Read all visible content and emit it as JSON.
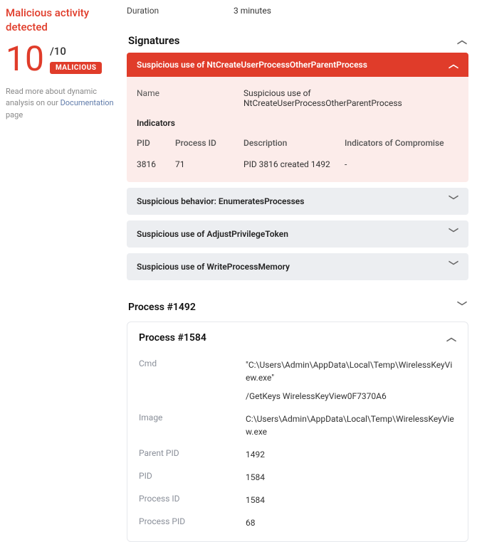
{
  "sidebar": {
    "title": "Malicious activity detected",
    "score": "10",
    "out_of": "/10",
    "badge": "MALICIOUS",
    "read_more_pre": "Read more about dynamic analysis on our ",
    "read_more_link": "Documentation",
    "read_more_post": " page"
  },
  "meta": {
    "duration_label": "Duration",
    "duration_value": "3 minutes"
  },
  "signatures": {
    "heading": "Signatures",
    "open": {
      "title": "Suspicious use of NtCreateUserProcessOtherParentProcess",
      "name_label": "Name",
      "name_value": "Suspicious use of NtCreateUserProcessOtherParentProcess",
      "indicators_label": "Indicators",
      "cols": {
        "pid": "PID",
        "proc": "Process ID",
        "desc": "Description",
        "ioc": "Indicators of Compromise"
      },
      "rows": [
        {
          "pid": "3816",
          "proc": "71",
          "desc": "PID 3816 created 1492",
          "ioc": "-"
        }
      ]
    },
    "collapsed": [
      "Suspicious behavior: EnumeratesProcesses",
      "Suspicious use of AdjustPrivilegeToken",
      "Suspicious use of WriteProcessMemory"
    ]
  },
  "processes": {
    "p1492": {
      "title": "Process #1492"
    },
    "p1584": {
      "title": "Process #1584",
      "rows": {
        "cmd_label": "Cmd",
        "cmd_v1": "\"C:\\Users\\Admin\\AppData\\Local\\Temp\\WirelessKeyView.exe\"",
        "cmd_v2": "/GetKeys WirelessKeyView0F7370A6",
        "image_label": "Image",
        "image_value": "C:\\Users\\Admin\\AppData\\Local\\Temp\\WirelessKeyView.exe",
        "ppid_label": "Parent PID",
        "ppid_value": "1492",
        "pid_label": "PID",
        "pid_value": "1584",
        "procid_label": "Process ID",
        "procid_value": "1584",
        "procpid_label": "Process PID",
        "procpid_value": "68"
      }
    }
  }
}
